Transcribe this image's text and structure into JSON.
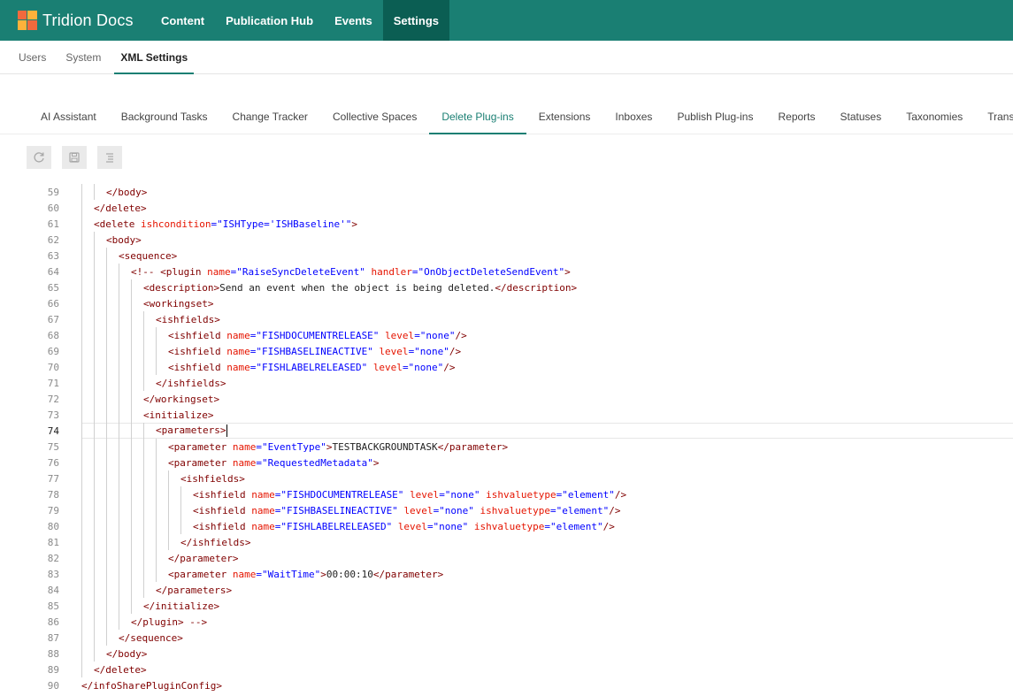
{
  "app": {
    "brand": "Tridion Docs",
    "nav": [
      "Content",
      "Publication Hub",
      "Events",
      "Settings"
    ],
    "active_nav": "Settings"
  },
  "subnav": {
    "items": [
      "Users",
      "System",
      "XML Settings"
    ],
    "active": "XML Settings"
  },
  "tabs": {
    "items": [
      "AI Assistant",
      "Background Tasks",
      "Change Tracker",
      "Collective Spaces",
      "Delete Plug-ins",
      "Extensions",
      "Inboxes",
      "Publish Plug-ins",
      "Reports",
      "Statuses",
      "Taxonomies",
      "Translations"
    ],
    "active": "Delete Plug-ins"
  },
  "toolbar": {
    "buttons": [
      "refresh-icon",
      "save-icon",
      "format-icon"
    ]
  },
  "colors": {
    "topbar": "#1a7f73",
    "topbar_active": "#0b5e53",
    "tag": "#800000",
    "attr": "#e51400",
    "value": "#0000ff",
    "comment": "#800000"
  },
  "editor": {
    "current_line": 74,
    "lines": [
      {
        "n": "59",
        "text": "</body>",
        "indent": 1
      },
      {
        "n": "60",
        "text": "</delete>",
        "indent": 0
      },
      {
        "n": "61",
        "text": "<delete ishcondition=\"ISHType='ISHBaseline'\">",
        "indent": 0
      },
      {
        "n": "62",
        "text": "<body>",
        "indent": 1
      },
      {
        "n": "63",
        "text": "<sequence>",
        "indent": 2
      },
      {
        "n": "64",
        "text": "<!-- <plugin name=\"RaiseSyncDeleteEvent\" handler=\"OnObjectDeleteSendEvent\">",
        "indent": 3
      },
      {
        "n": "65",
        "text": "<description>Send an event when the object is being deleted.</description>",
        "indent": 4
      },
      {
        "n": "66",
        "text": "<workingset>",
        "indent": 4
      },
      {
        "n": "67",
        "text": "<ishfields>",
        "indent": 5
      },
      {
        "n": "68",
        "text": "<ishfield name=\"FISHDOCUMENTRELEASE\" level=\"none\"/>",
        "indent": 6
      },
      {
        "n": "69",
        "text": "<ishfield name=\"FISHBASELINEACTIVE\" level=\"none\"/>",
        "indent": 6
      },
      {
        "n": "70",
        "text": "<ishfield name=\"FISHLABELRELEASED\" level=\"none\"/>",
        "indent": 6
      },
      {
        "n": "71",
        "text": "</ishfields>",
        "indent": 5
      },
      {
        "n": "72",
        "text": "</workingset>",
        "indent": 4
      },
      {
        "n": "73",
        "text": "<initialize>",
        "indent": 4
      },
      {
        "n": "74",
        "text": "<parameters>",
        "indent": 5
      },
      {
        "n": "75",
        "text": "<parameter name=\"EventType\">TESTBACKGROUNDTASK</parameter>",
        "indent": 6
      },
      {
        "n": "76",
        "text": "<parameter name=\"RequestedMetadata\">",
        "indent": 6
      },
      {
        "n": "77",
        "text": "<ishfields>",
        "indent": 7
      },
      {
        "n": "78",
        "text": "<ishfield name=\"FISHDOCUMENTRELEASE\" level=\"none\" ishvaluetype=\"element\"/>",
        "indent": 8
      },
      {
        "n": "79",
        "text": "<ishfield name=\"FISHBASELINEACTIVE\" level=\"none\" ishvaluetype=\"element\"/>",
        "indent": 8
      },
      {
        "n": "80",
        "text": "<ishfield name=\"FISHLABELRELEASED\" level=\"none\" ishvaluetype=\"element\"/>",
        "indent": 8
      },
      {
        "n": "81",
        "text": "</ishfields>",
        "indent": 7
      },
      {
        "n": "82",
        "text": "</parameter>",
        "indent": 6
      },
      {
        "n": "83",
        "text": "<parameter name=\"WaitTime\">00:00:10</parameter>",
        "indent": 6
      },
      {
        "n": "84",
        "text": "</parameters>",
        "indent": 5
      },
      {
        "n": "85",
        "text": "</initialize>",
        "indent": 4
      },
      {
        "n": "86",
        "text": "</plugin> -->",
        "indent": 3
      },
      {
        "n": "87",
        "text": "</sequence>",
        "indent": 2
      },
      {
        "n": "88",
        "text": "</body>",
        "indent": 1
      },
      {
        "n": "89",
        "text": "</delete>",
        "indent": 0
      },
      {
        "n": "90",
        "text": "</infoSharePluginConfig>",
        "indent": -1
      }
    ]
  }
}
